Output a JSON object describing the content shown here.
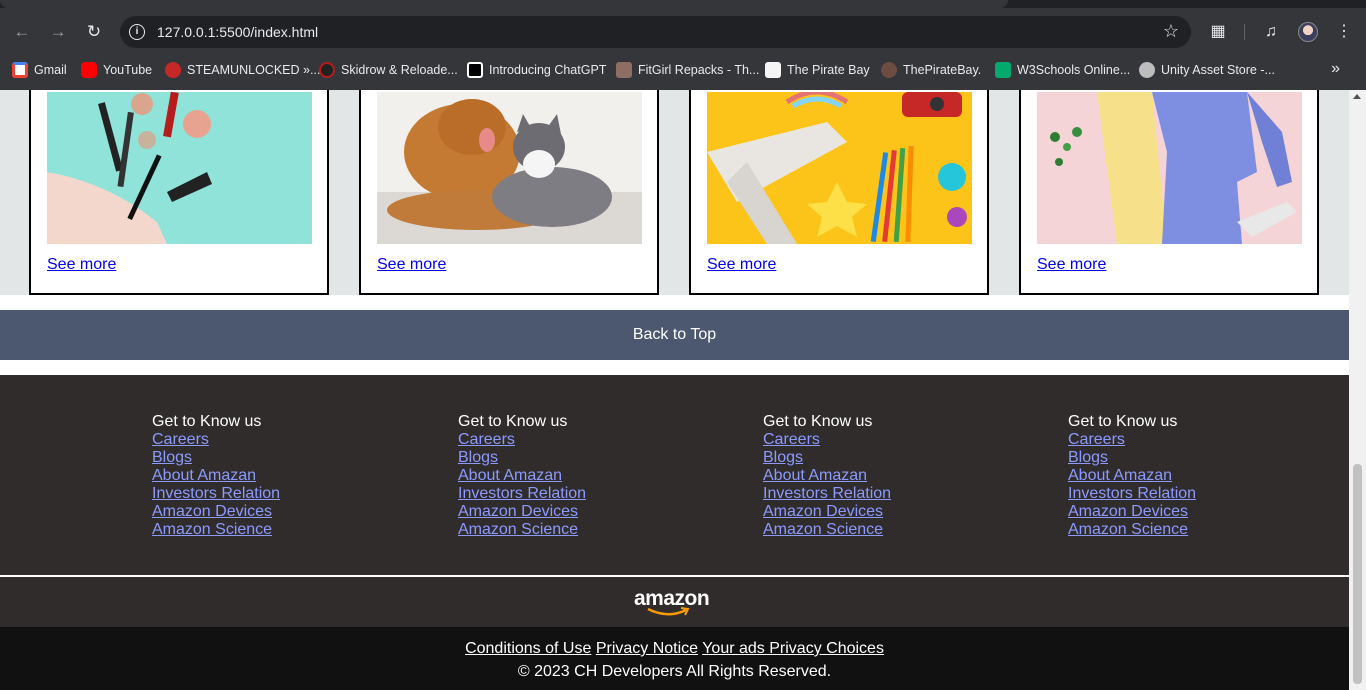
{
  "browser": {
    "url": "127.0.0.1:5500/index.html",
    "bookmarks": [
      {
        "label": "Gmail",
        "color": "#ea4335"
      },
      {
        "label": "YouTube",
        "color": "#ff0000"
      },
      {
        "label": "STEAMUNLOCKED »...",
        "color": "#c62828"
      },
      {
        "label": "Skidrow & Reloade...",
        "color": "#b71c1c"
      },
      {
        "label": "Introducing ChatGPT",
        "color": "#ffffff"
      },
      {
        "label": "FitGirl Repacks - Th...",
        "color": "#8d6e63"
      },
      {
        "label": "The Pirate Bay",
        "color": "#f5f5f5"
      },
      {
        "label": "ThePirateBay.",
        "color": "#6d4c41"
      },
      {
        "label": "W3Schools Online...",
        "color": "#04aa6d"
      },
      {
        "label": "Unity Asset Store -...",
        "color": "#bdbdbd"
      }
    ]
  },
  "cards": [
    {
      "link": "See more",
      "image": "makeup-products"
    },
    {
      "link": "See more",
      "image": "dog-and-cat"
    },
    {
      "link": "See more",
      "image": "toys-and-pencils"
    },
    {
      "link": "See more",
      "image": "fashion-clothing"
    }
  ],
  "back_to_top": "Back to Top",
  "footer": {
    "columns": [
      {
        "heading": "Get to Know us",
        "links": [
          "Careers",
          "Blogs",
          "About Amazan",
          "Investors Relation",
          "Amazon Devices",
          "Amazon Science"
        ]
      },
      {
        "heading": "Get to Know us",
        "links": [
          "Careers",
          "Blogs",
          "About Amazan",
          "Investors Relation",
          "Amazon Devices",
          "Amazon Science"
        ]
      },
      {
        "heading": "Get to Know us",
        "links": [
          "Careers",
          "Blogs",
          "About Amazan",
          "Investors Relation",
          "Amazon Devices",
          "Amazon Science"
        ]
      },
      {
        "heading": "Get to Know us",
        "links": [
          "Careers",
          "Blogs",
          "About Amazan",
          "Investors Relation",
          "Amazon Devices",
          "Amazon Science"
        ]
      }
    ],
    "logo": "amazon",
    "legal_links": [
      "Conditions of Use",
      "Privacy Notice",
      "Your ads Privacy Choices"
    ],
    "copyright": "© 2023 CH Developers All Rights Reserved."
  }
}
